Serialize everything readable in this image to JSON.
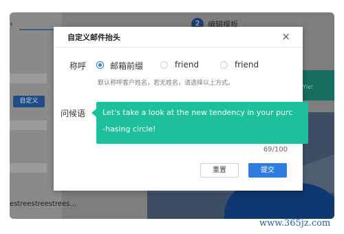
{
  "background": {
    "step_number": "2",
    "step_label": "编辑模板",
    "sidebar_button": "自定义",
    "sidebar_text": "estreestreestrees...",
    "panel_snippet": "Yle!"
  },
  "modal": {
    "title": "自定义邮件抬头",
    "close": "×",
    "salutation_label": "称呼",
    "options": [
      {
        "label": "邮箱前缀",
        "selected": true
      },
      {
        "label": "friend",
        "selected": false
      },
      {
        "label": "friend",
        "selected": false
      }
    ],
    "hint": "默认称呼客户姓名，若无姓名，请选择以上方式。",
    "greeting_label": "问候语",
    "greeting_line1": "Let's take a look at the new tendency in your purc",
    "greeting_line2": "-hasing circle!",
    "char_count": "69/100",
    "reset_button": "重置",
    "submit_button": "提交"
  },
  "watermark": "www.365jz.com",
  "colors": {
    "accent": "#2f7ce0",
    "tooltip": "#1cc09a",
    "overlay": "#7d7d7d"
  }
}
